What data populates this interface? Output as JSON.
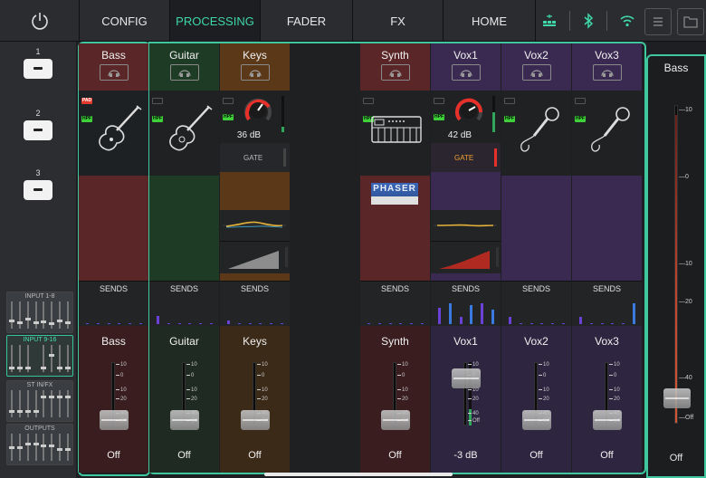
{
  "topbar": {
    "tabs": [
      {
        "label": "CONFIG",
        "active": false
      },
      {
        "label": "PROCESSING",
        "active": true
      },
      {
        "label": "FADER",
        "active": false
      },
      {
        "label": "FX",
        "active": false
      },
      {
        "label": "HOME",
        "active": false
      }
    ],
    "accent_color": "#3fd7a6"
  },
  "sidebar": {
    "layers": [
      "1",
      "2",
      "3"
    ],
    "banks": [
      {
        "label": "INPUT 1-8",
        "active": false
      },
      {
        "label": "INPUT 9-16",
        "active": true
      },
      {
        "label": "ST IN/FX",
        "active": false
      },
      {
        "label": "OUTPUTS",
        "active": false
      }
    ]
  },
  "channels": [
    {
      "name": "Bass",
      "color": "#5a2628",
      "fx_color": "#5a2628",
      "fader_color": "#3a1d1f",
      "instrument": "bass-guitar-icon",
      "pad": true,
      "hpf": true,
      "gain": "",
      "gate": "",
      "fx": "",
      "sends_label": "SENDS",
      "fader_value": "Off",
      "fader_level": 0.08,
      "sends": [
        0.02,
        0.02,
        0.02,
        0.02,
        0.02,
        0.02
      ]
    },
    {
      "name": "Guitar",
      "color": "#1d3b25",
      "fx_color": "#1d3b25",
      "fader_color": "#1f2b22",
      "instrument": "guitar-icon",
      "pad": false,
      "hpf": true,
      "gain": "",
      "gate": "",
      "fx": "",
      "sends_label": "SENDS",
      "fader_value": "Off",
      "fader_level": 0.08,
      "sends": [
        0.35,
        0.02,
        0.02,
        0.02,
        0.02,
        0.02
      ]
    },
    {
      "name": "Keys",
      "color": "#5b3818",
      "fx_color": "#5b3818",
      "fader_color": "#3b2a18",
      "instrument": "gain-knob-icon",
      "pad": false,
      "hpf": true,
      "gain": "36 dB",
      "gate": "GATE",
      "fx": "eq-comp",
      "sends_label": "SENDS",
      "fader_value": "Off",
      "fader_level": 0.08,
      "sends": [
        0.15,
        0.02,
        0.05,
        0.02,
        0.02,
        0.02
      ]
    },
    {
      "name": "Synth",
      "color": "#5a2628",
      "fx_color": "#5a2628",
      "fader_color": "#3a1d1f",
      "instrument": "keyboard-icon",
      "pad": false,
      "hpf": true,
      "gain": "",
      "gate": "",
      "fx": "phaser",
      "fx_label": "PHASER",
      "sends_label": "SENDS",
      "fader_value": "Off",
      "fader_level": 0.08,
      "sends": [
        0.02,
        0.02,
        0.02,
        0.02,
        0.02,
        0.02
      ]
    },
    {
      "name": "Vox1",
      "color": "#3a2a52",
      "fx_color": "#3a2a52",
      "fader_color": "#2e2640",
      "instrument": "gain-knob-icon",
      "pad": false,
      "hpf": true,
      "gain": "42 dB",
      "gate": "GATE",
      "fx": "eq-comp",
      "sends_label": "SENDS",
      "fader_value": "-3 dB",
      "fader_level": 0.74,
      "sends": [
        0.7,
        0.9,
        0.3,
        0.8,
        0.9,
        0.6
      ]
    },
    {
      "name": "Vox2",
      "color": "#3a2a52",
      "fx_color": "#3a2a52",
      "fader_color": "#2e2640",
      "instrument": "microphone-icon",
      "pad": false,
      "hpf": true,
      "gain": "",
      "gate": "",
      "fx": "",
      "sends_label": "SENDS",
      "fader_value": "Off",
      "fader_level": 0.08,
      "sends": [
        0.3,
        0.02,
        0.05,
        0.02,
        0.02,
        0.02
      ]
    },
    {
      "name": "Vox3",
      "color": "#3a2a52",
      "fx_color": "#3a2a52",
      "fader_color": "#2e2640",
      "instrument": "microphone-icon",
      "pad": false,
      "hpf": true,
      "gain": "",
      "gate": "",
      "fx": "",
      "sends_label": "SENDS",
      "fader_value": "Off",
      "fader_level": 0.08,
      "sends": [
        0.3,
        0.02,
        0.05,
        0.02,
        0.02,
        0.9
      ]
    }
  ],
  "fader_scale": [
    "10",
    "0",
    "10",
    "20",
    "40",
    "Off"
  ],
  "dca": {
    "name": "Bass",
    "fader_value": "Off",
    "fader_level": 0.08,
    "scale": [
      "10",
      "0",
      "10",
      "20",
      "40",
      "Off"
    ]
  }
}
